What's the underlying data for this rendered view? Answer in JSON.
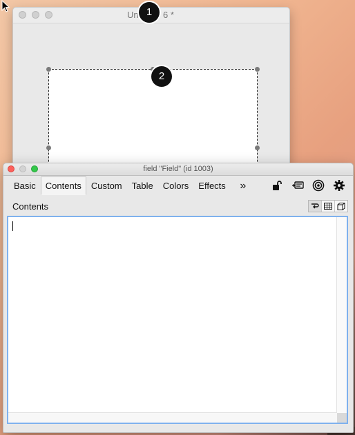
{
  "back_window": {
    "title": "Un",
    "title_suffix": "6 *"
  },
  "badges": {
    "first": "1",
    "second": "2"
  },
  "inspector": {
    "title": "field \"Field\" (id 1003)",
    "tabs": [
      {
        "label": "Basic"
      },
      {
        "label": "Contents"
      },
      {
        "label": "Custom"
      },
      {
        "label": "Table"
      },
      {
        "label": "Colors"
      },
      {
        "label": "Effects"
      }
    ],
    "more_label": "»",
    "section_label": "Contents",
    "editor_value": ""
  },
  "colors": {
    "selection_border": "#7fb1ee",
    "close": "#fc605b",
    "zoom": "#34c84a"
  },
  "icons": [
    "lock-icon",
    "message-icon",
    "target-icon",
    "gear-icon",
    "wrap-icon",
    "table-icon",
    "cube-icon"
  ]
}
